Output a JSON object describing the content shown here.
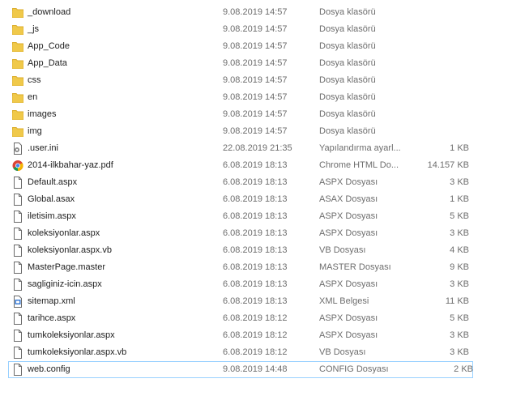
{
  "colors": {
    "folder": "#f0c94a",
    "folder_dark": "#dcae2e",
    "file_border": "#6a6a6a",
    "selection_border": "#99d1ff",
    "secondary_text": "#6d6d6d"
  },
  "files": [
    {
      "name": "_download",
      "date": "9.08.2019 14:57",
      "type": "Dosya klasörü",
      "size": "",
      "icon": "folder-icon"
    },
    {
      "name": "_js",
      "date": "9.08.2019 14:57",
      "type": "Dosya klasörü",
      "size": "",
      "icon": "folder-icon"
    },
    {
      "name": "App_Code",
      "date": "9.08.2019 14:57",
      "type": "Dosya klasörü",
      "size": "",
      "icon": "folder-icon"
    },
    {
      "name": "App_Data",
      "date": "9.08.2019 14:57",
      "type": "Dosya klasörü",
      "size": "",
      "icon": "folder-icon"
    },
    {
      "name": "css",
      "date": "9.08.2019 14:57",
      "type": "Dosya klasörü",
      "size": "",
      "icon": "folder-icon"
    },
    {
      "name": "en",
      "date": "9.08.2019 14:57",
      "type": "Dosya klasörü",
      "size": "",
      "icon": "folder-icon"
    },
    {
      "name": "images",
      "date": "9.08.2019 14:57",
      "type": "Dosya klasörü",
      "size": "",
      "icon": "folder-icon"
    },
    {
      "name": "img",
      "date": "9.08.2019 14:57",
      "type": "Dosya klasörü",
      "size": "",
      "icon": "folder-icon"
    },
    {
      "name": ".user.ini",
      "date": "22.08.2019 21:35",
      "type": "Yapılandırma ayarl...",
      "size": "1 KB",
      "icon": "settings-file-icon"
    },
    {
      "name": "2014-ilkbahar-yaz.pdf",
      "date": "6.08.2019 18:13",
      "type": "Chrome HTML Do...",
      "size": "14.157 KB",
      "icon": "chrome-icon"
    },
    {
      "name": "Default.aspx",
      "date": "6.08.2019 18:13",
      "type": "ASPX Dosyası",
      "size": "3 KB",
      "icon": "file-icon"
    },
    {
      "name": "Global.asax",
      "date": "6.08.2019 18:13",
      "type": "ASAX Dosyası",
      "size": "1 KB",
      "icon": "file-icon"
    },
    {
      "name": "iletisim.aspx",
      "date": "6.08.2019 18:13",
      "type": "ASPX Dosyası",
      "size": "5 KB",
      "icon": "file-icon"
    },
    {
      "name": "koleksiyonlar.aspx",
      "date": "6.08.2019 18:13",
      "type": "ASPX Dosyası",
      "size": "3 KB",
      "icon": "file-icon"
    },
    {
      "name": "koleksiyonlar.aspx.vb",
      "date": "6.08.2019 18:13",
      "type": "VB Dosyası",
      "size": "4 KB",
      "icon": "file-icon"
    },
    {
      "name": "MasterPage.master",
      "date": "6.08.2019 18:13",
      "type": "MASTER Dosyası",
      "size": "9 KB",
      "icon": "file-icon"
    },
    {
      "name": "sagliginiz-icin.aspx",
      "date": "6.08.2019 18:13",
      "type": "ASPX Dosyası",
      "size": "3 KB",
      "icon": "file-icon"
    },
    {
      "name": "sitemap.xml",
      "date": "6.08.2019 18:13",
      "type": "XML Belgesi",
      "size": "11 KB",
      "icon": "xml-file-icon"
    },
    {
      "name": "tarihce.aspx",
      "date": "6.08.2019 18:12",
      "type": "ASPX Dosyası",
      "size": "5 KB",
      "icon": "file-icon"
    },
    {
      "name": "tumkoleksiyonlar.aspx",
      "date": "6.08.2019 18:12",
      "type": "ASPX Dosyası",
      "size": "3 KB",
      "icon": "file-icon"
    },
    {
      "name": "tumkoleksiyonlar.aspx.vb",
      "date": "6.08.2019 18:12",
      "type": "VB Dosyası",
      "size": "3 KB",
      "icon": "file-icon"
    },
    {
      "name": "web.config",
      "date": "9.08.2019 14:48",
      "type": "CONFIG Dosyası",
      "size": "2 KB",
      "icon": "file-icon",
      "selected": true
    }
  ]
}
